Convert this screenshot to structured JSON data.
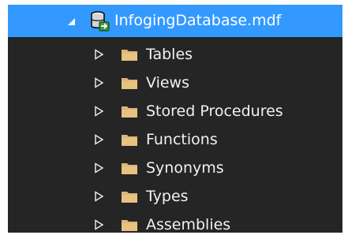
{
  "tree": {
    "root": {
      "label": "InfogingDatabase.mdf",
      "icon": "database-icon",
      "expanded": true,
      "selected": true,
      "selection_color": "#3399ff"
    },
    "children": [
      {
        "label": "Tables",
        "icon": "folder-icon",
        "expander_icon": "collapsed-triangle-icon"
      },
      {
        "label": "Views",
        "icon": "folder-icon",
        "expander_icon": "collapsed-triangle-icon"
      },
      {
        "label": "Stored Procedures",
        "icon": "folder-icon",
        "expander_icon": "collapsed-triangle-icon"
      },
      {
        "label": "Functions",
        "icon": "folder-icon",
        "expander_icon": "collapsed-triangle-icon"
      },
      {
        "label": "Synonyms",
        "icon": "folder-icon",
        "expander_icon": "collapsed-triangle-icon"
      },
      {
        "label": "Types",
        "icon": "folder-icon",
        "expander_icon": "collapsed-triangle-icon"
      },
      {
        "label": "Assemblies",
        "icon": "folder-icon",
        "expander_icon": "collapsed-triangle-icon"
      }
    ],
    "colors": {
      "background": "#252526",
      "text": "#f1f1f1",
      "folder": "#dcb67a"
    }
  }
}
